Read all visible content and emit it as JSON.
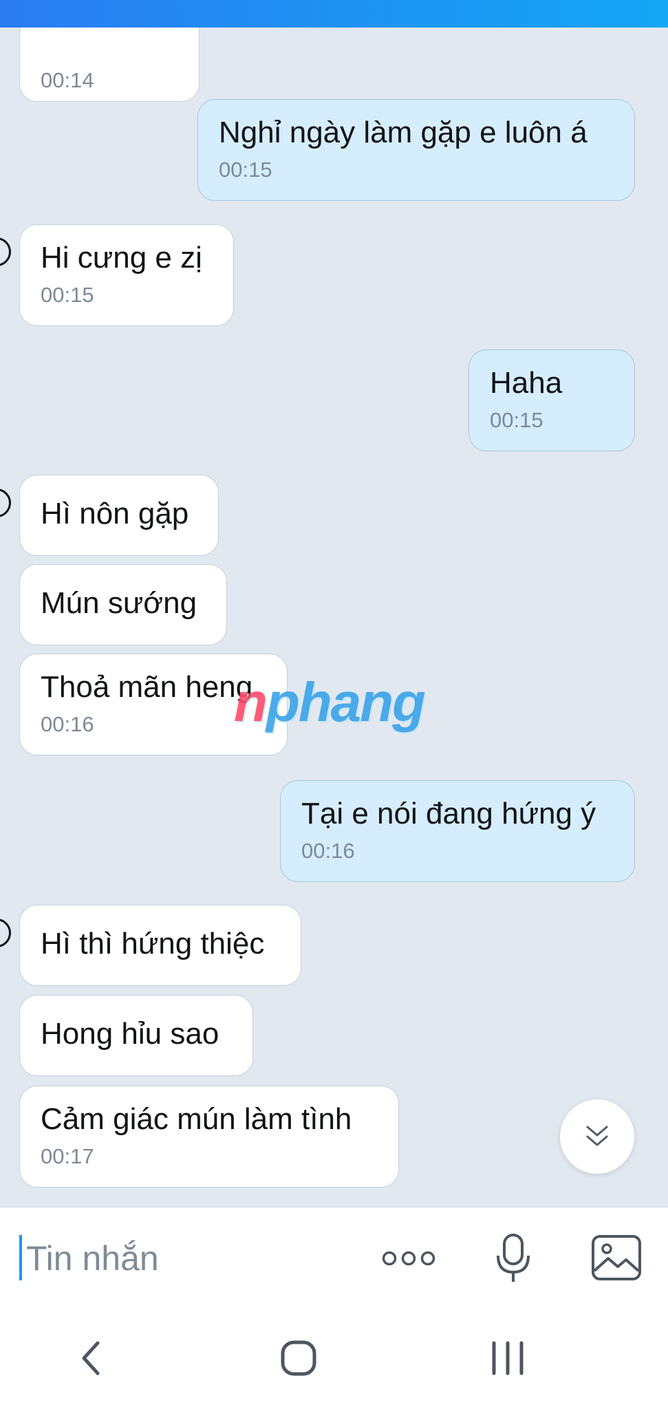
{
  "messages": [
    {
      "side": "in",
      "text": "",
      "time": "00:14"
    },
    {
      "side": "out",
      "text": "Nghỉ ngày làm gặp e luôn á",
      "time": "00:15"
    },
    {
      "side": "in",
      "text": "Hi cưng e zị",
      "time": "00:15"
    },
    {
      "side": "out",
      "text": "Haha",
      "time": "00:15"
    },
    {
      "side": "in",
      "text": "Hì nôn gặp",
      "time": ""
    },
    {
      "side": "in",
      "text": "Mún sướng",
      "time": ""
    },
    {
      "side": "in",
      "text": "Thoả mãn heng",
      "time": "00:16"
    },
    {
      "side": "out",
      "text": "Tại e nói đang hứng ý",
      "time": "00:16"
    },
    {
      "side": "in",
      "text": "Hì thì hứng thiệc",
      "time": ""
    },
    {
      "side": "in",
      "text": "Hong hỉu sao",
      "time": ""
    },
    {
      "side": "in",
      "text": "Cảm giác mún làm tình",
      "time": "00:17"
    }
  ],
  "watermark": {
    "first": "n",
    "rest": "phang"
  },
  "input": {
    "placeholder": "Tin nhắn",
    "value": ""
  },
  "icons": {
    "scroll_down": "double-chevron-down-icon",
    "more": "more-options-icon",
    "mic": "microphone-icon",
    "image": "image-icon",
    "nav_back": "back-icon",
    "nav_home": "home-icon",
    "nav_recents": "recents-icon"
  },
  "colors": {
    "topbar_start": "#2a7cf0",
    "topbar_end": "#14a6f5",
    "outgoing_bubble": "#d5edfd",
    "incoming_bubble": "#ffffff",
    "chat_background": "#e2e8f0"
  }
}
